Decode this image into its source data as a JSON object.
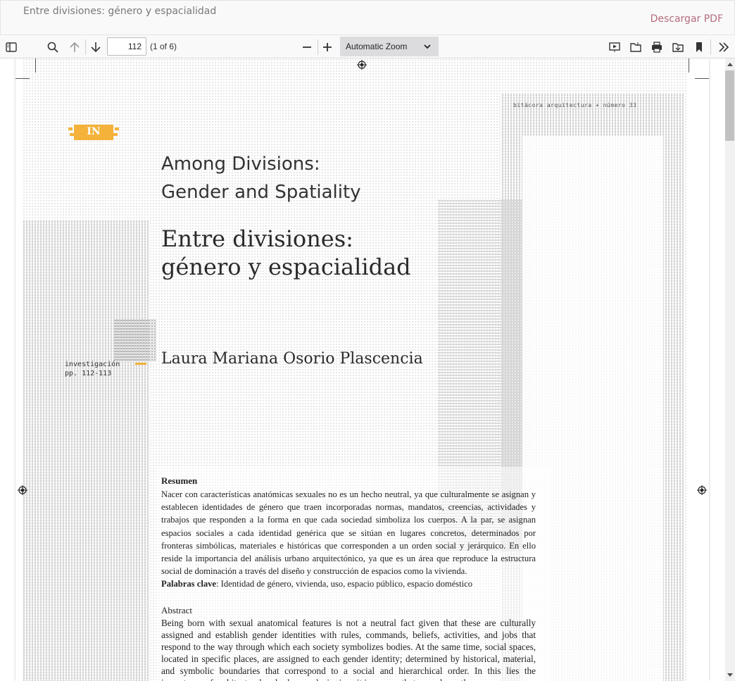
{
  "header": {
    "title": "Entre divisiones: género y espacialidad",
    "download_label": "Descargar PDF"
  },
  "toolbar": {
    "page_number": "112",
    "page_count": "(1 of 6)",
    "zoom": "Automatic Zoom",
    "icons": [
      "sidebar-toggle-icon",
      "search-icon",
      "arrow-up-icon",
      "arrow-down-icon",
      "zoom-out-icon",
      "zoom-in-icon",
      "presentation-icon",
      "open-file-icon",
      "print-icon",
      "download-icon",
      "bookmark-icon",
      "tools-chevron-icon"
    ]
  },
  "document": {
    "journal_tag": "bitácora arquitectura + número 33",
    "badge": "IN",
    "title_en_line1": "Among Divisions:",
    "title_en_line2": "Gender and Spatiality",
    "title_es_line1": "Entre divisiones:",
    "title_es_line2": "género y espacialidad",
    "section_line1": "investigación",
    "section_line2": "pp. 112-113",
    "author": "Laura Mariana Osorio Plascencia",
    "resumen_heading": "Resumen",
    "resumen_body": "Nacer con características anatómicas sexuales no es un hecho neutral, ya que culturalmente se asignan y establecen identidades de género que traen incorporadas normas, mandatos, creencias, actividades y trabajos que responden a la forma en que cada sociedad simboliza los cuerpos. A la par, se asignan espacios sociales a cada identidad genérica que se sitúan en lugares concretos, determinados por fronteras simbólicas, materiales e históricas que corresponden a un orden social y jerárquico. En ello reside la importancia del análisis urbano arquitectónico, ya que es un área que reproduce la estructura social de dominación a través del diseño y construcción de espacios como la vivienda.",
    "keywords_label": "Palabras clave",
    "keywords": ": Identidad de género, vivienda, uso, espacio público, espacio doméstico",
    "abstract_heading": "Abstract",
    "abstract_body": "Being born with sexual anatomical features is not a neutral fact given that these are culturally assigned and establish gender identities with rules, commands, beliefs, activities, and jobs that respond to the way through which each society symbolizes bodies. At the same time, social spaces, located in specific places, are assigned to each gender identity; determined by historical, material, and symbolic boundaries that correspond to a social and hierarchical order. In this lies the importance of architectural and urban analysis since it is an area that reproduces the"
  },
  "colors": {
    "accent": "#f4b23a",
    "download": "#b56d7b",
    "toolbar_bg": "#f9f9fa",
    "zoom_bg": "#dcdcdf"
  }
}
